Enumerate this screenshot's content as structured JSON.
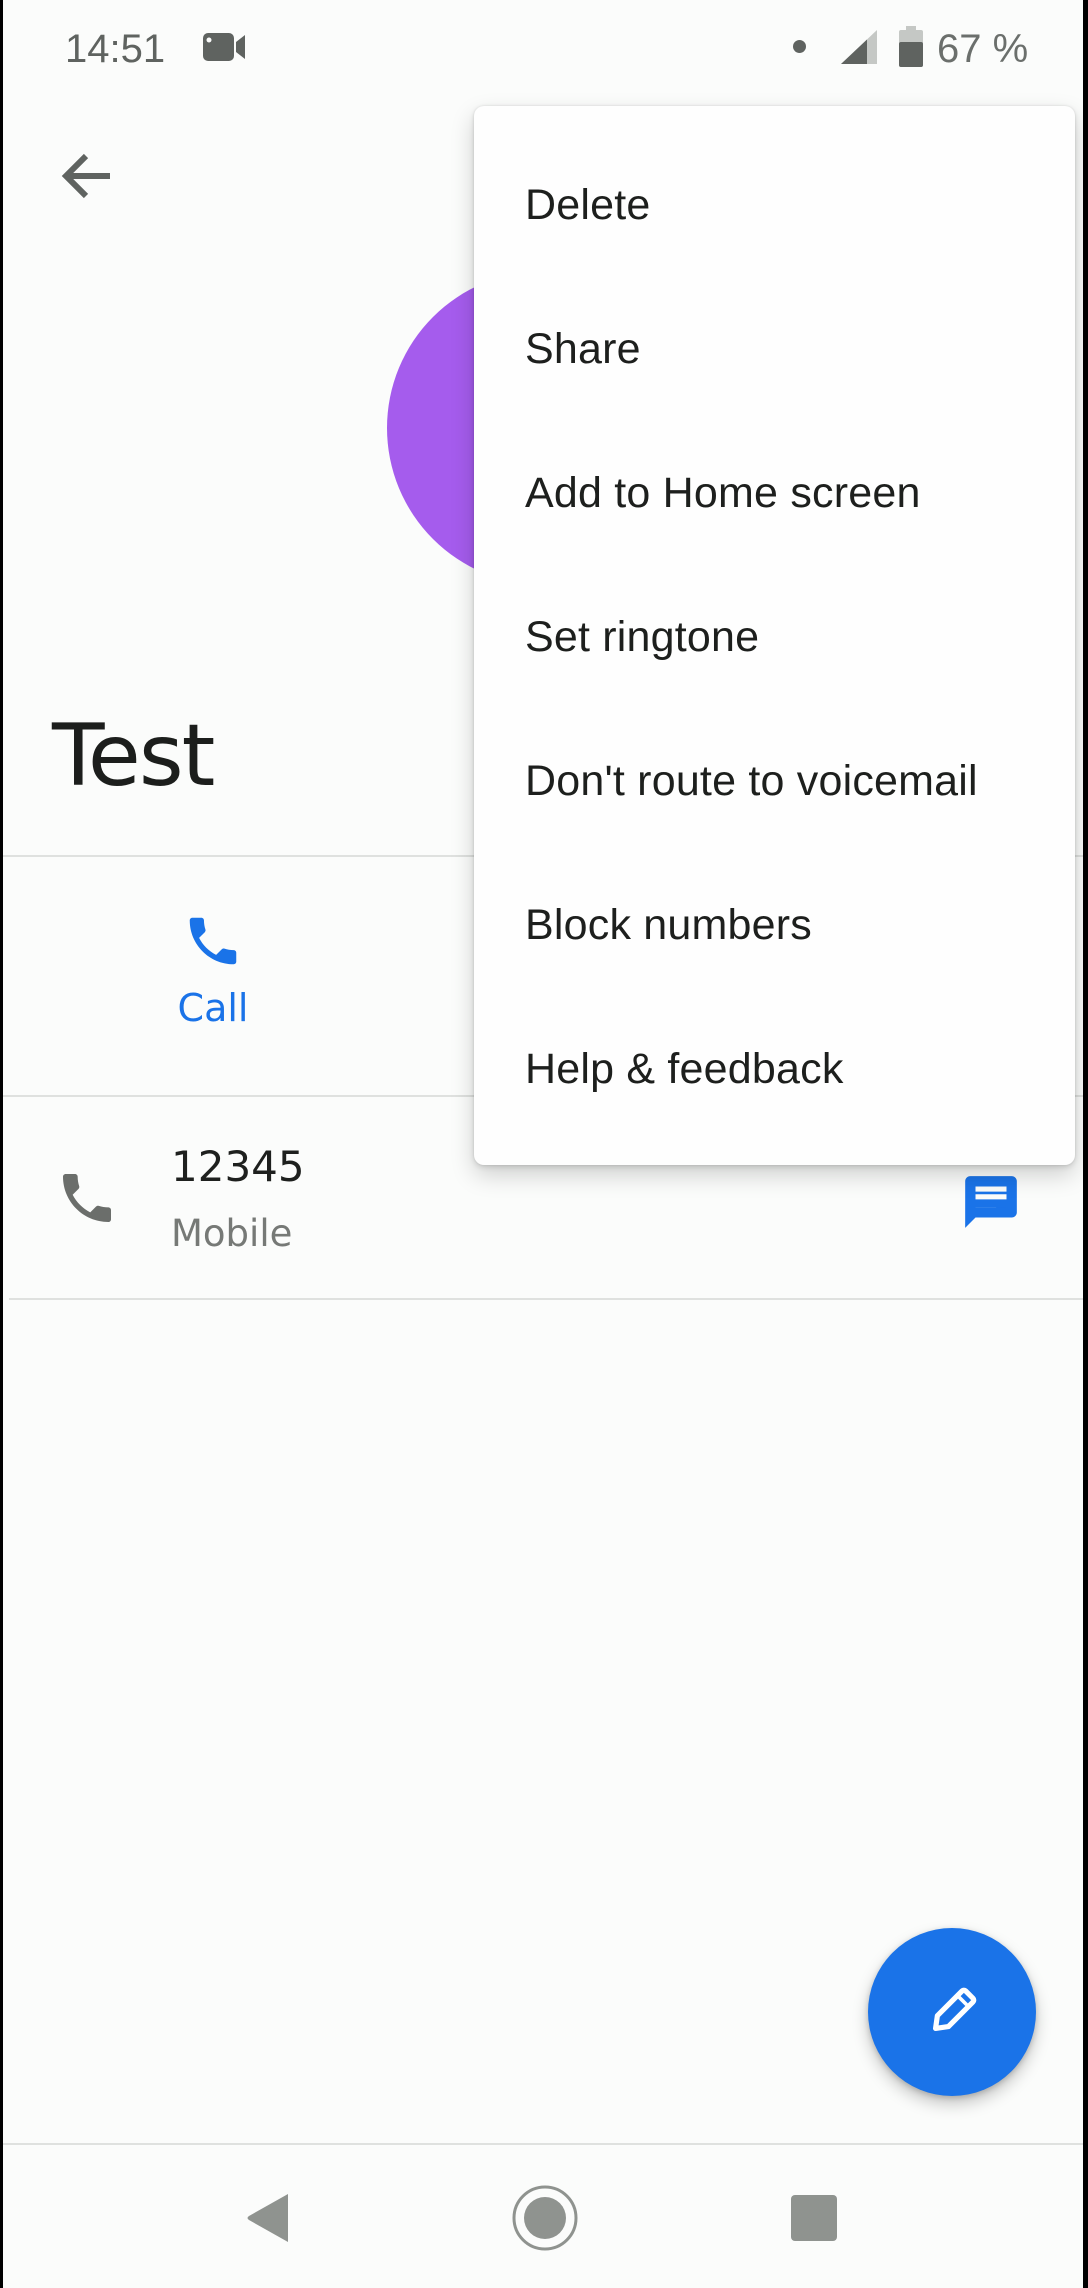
{
  "status_bar": {
    "time": "14:51",
    "left_icons": [
      "video-camera-icon"
    ],
    "right_icons": [
      "notification-dot-icon",
      "signal-icon",
      "battery-icon"
    ],
    "battery_percent": "67 %",
    "battery_level": 0.67
  },
  "app_bar": {
    "back_icon": "arrow-back-icon"
  },
  "contact": {
    "name": "Test",
    "avatar_color": "#a55ced"
  },
  "actions": {
    "call_label": "Call",
    "call_icon": "phone-icon",
    "accent_color": "#1a73e8"
  },
  "phone_entries": [
    {
      "number": "12345",
      "type": "Mobile",
      "icon": "phone-icon",
      "secondary_action_icon": "message-icon"
    }
  ],
  "fab": {
    "icon": "pencil-edit-icon",
    "color": "#1a73e8"
  },
  "overflow_menu": {
    "items": [
      {
        "label": "Delete"
      },
      {
        "label": "Share"
      },
      {
        "label": "Add to Home screen"
      },
      {
        "label": "Set ringtone"
      },
      {
        "label": "Don't route to voicemail"
      },
      {
        "label": "Block numbers"
      },
      {
        "label": "Help & feedback"
      }
    ]
  },
  "nav_bar": {
    "buttons": [
      "back-triangle-icon",
      "home-circle-icon",
      "recents-square-icon"
    ]
  }
}
